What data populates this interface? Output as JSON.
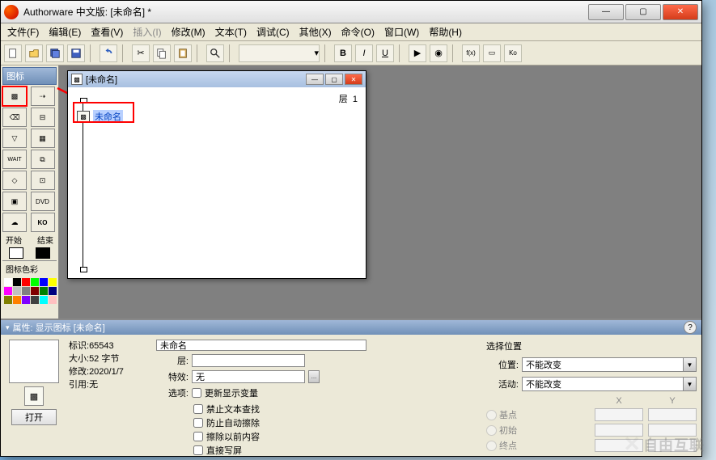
{
  "window": {
    "title": "Authorware 中文版: [未命名] *"
  },
  "menu": {
    "file": "文件(F)",
    "edit": "编辑(E)",
    "view": "查看(V)",
    "insert": "插入(I)",
    "modify": "修改(M)",
    "text": "文本(T)",
    "debug": "调试(C)",
    "other": "其他(X)",
    "command": "命令(O)",
    "window_m": "窗口(W)",
    "help": "帮助(H)"
  },
  "palette": {
    "title": "图标",
    "start": "开始",
    "end": "结束",
    "color_title": "图标色彩"
  },
  "doc": {
    "title": "[未命名]",
    "layer_label": "层",
    "layer_value": "1",
    "node_name": "未命名"
  },
  "prop": {
    "header": "属性: 显示图标 [未命名]",
    "id_label": "标识:",
    "id_value": "65543",
    "size_label": "大小:",
    "size_value": "52 字节",
    "mod_label": "修改:",
    "mod_value": "2020/1/7",
    "ref_label": "引用:",
    "ref_value": "无",
    "open_btn": "打开",
    "title_input": "未命名",
    "layer_label": "层:",
    "effect_label": "特效:",
    "effect_value": "无",
    "option_label": "选项:",
    "chk1": "更新显示变量",
    "chk2": "禁止文本查找",
    "chk3": "防止自动擦除",
    "chk4": "擦除以前内容",
    "chk5": "直接写屏",
    "pos_section": "选择位置",
    "pos_label": "位置:",
    "pos_value": "不能改变",
    "activity_label": "活动:",
    "activity_value": "不能改变",
    "xlabel": "X",
    "ylabel": "Y",
    "base": "基点",
    "init": "初始",
    "end": "终点"
  },
  "colors": [
    "#ffffff",
    "#000000",
    "#ff0000",
    "#00ff00",
    "#0000ff",
    "#ffff00",
    "#ff00ff",
    "#c0c0c0",
    "#808080",
    "#800000",
    "#008000",
    "#000080",
    "#808000",
    "#ff8000",
    "#8000ff",
    "#404040",
    "#00ffff",
    "#ffc0c0"
  ],
  "watermark": "自由互联"
}
